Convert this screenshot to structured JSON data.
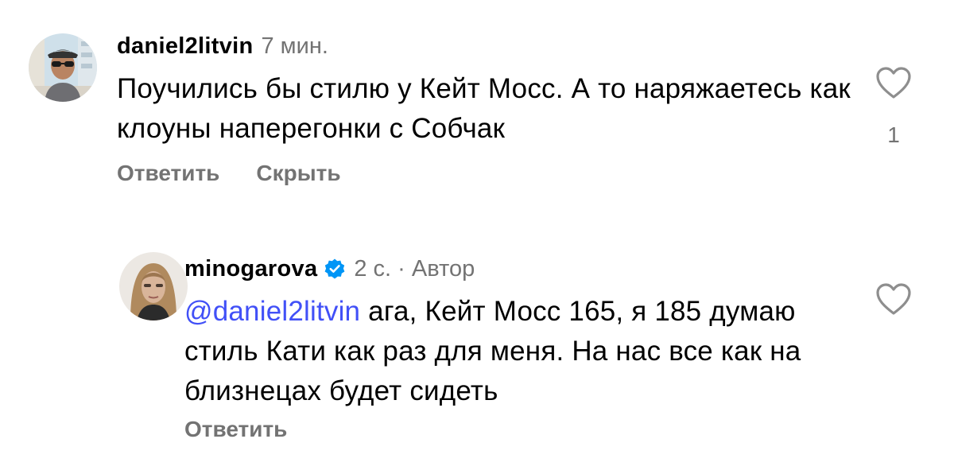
{
  "comments": [
    {
      "username": "daniel2litvin",
      "time": "7 мин.",
      "text": "Поучились бы стилю у Кейт Мосс. А то наряжаетесь как клоуны наперегонки с Собчак",
      "actions": {
        "reply": "Ответить",
        "hide": "Скрыть"
      },
      "likes": "1",
      "icons": {
        "like": "heart-outline-icon"
      }
    },
    {
      "username": "minogarova",
      "verified": true,
      "meta": "2 с. · Автор",
      "mention": "@daniel2litvin",
      "text": " ага, Кейт Мосс 165, я 185 думаю стиль Кати как раз для меня. На нас все как на близнецах будет сидеть",
      "actions": {
        "reply": "Ответить"
      },
      "icons": {
        "like": "heart-outline-icon",
        "verified": "verified-badge-icon"
      }
    }
  ],
  "colors": {
    "mention": "#4150f7",
    "verified": "#0095f6",
    "secondary_text": "#737373"
  }
}
